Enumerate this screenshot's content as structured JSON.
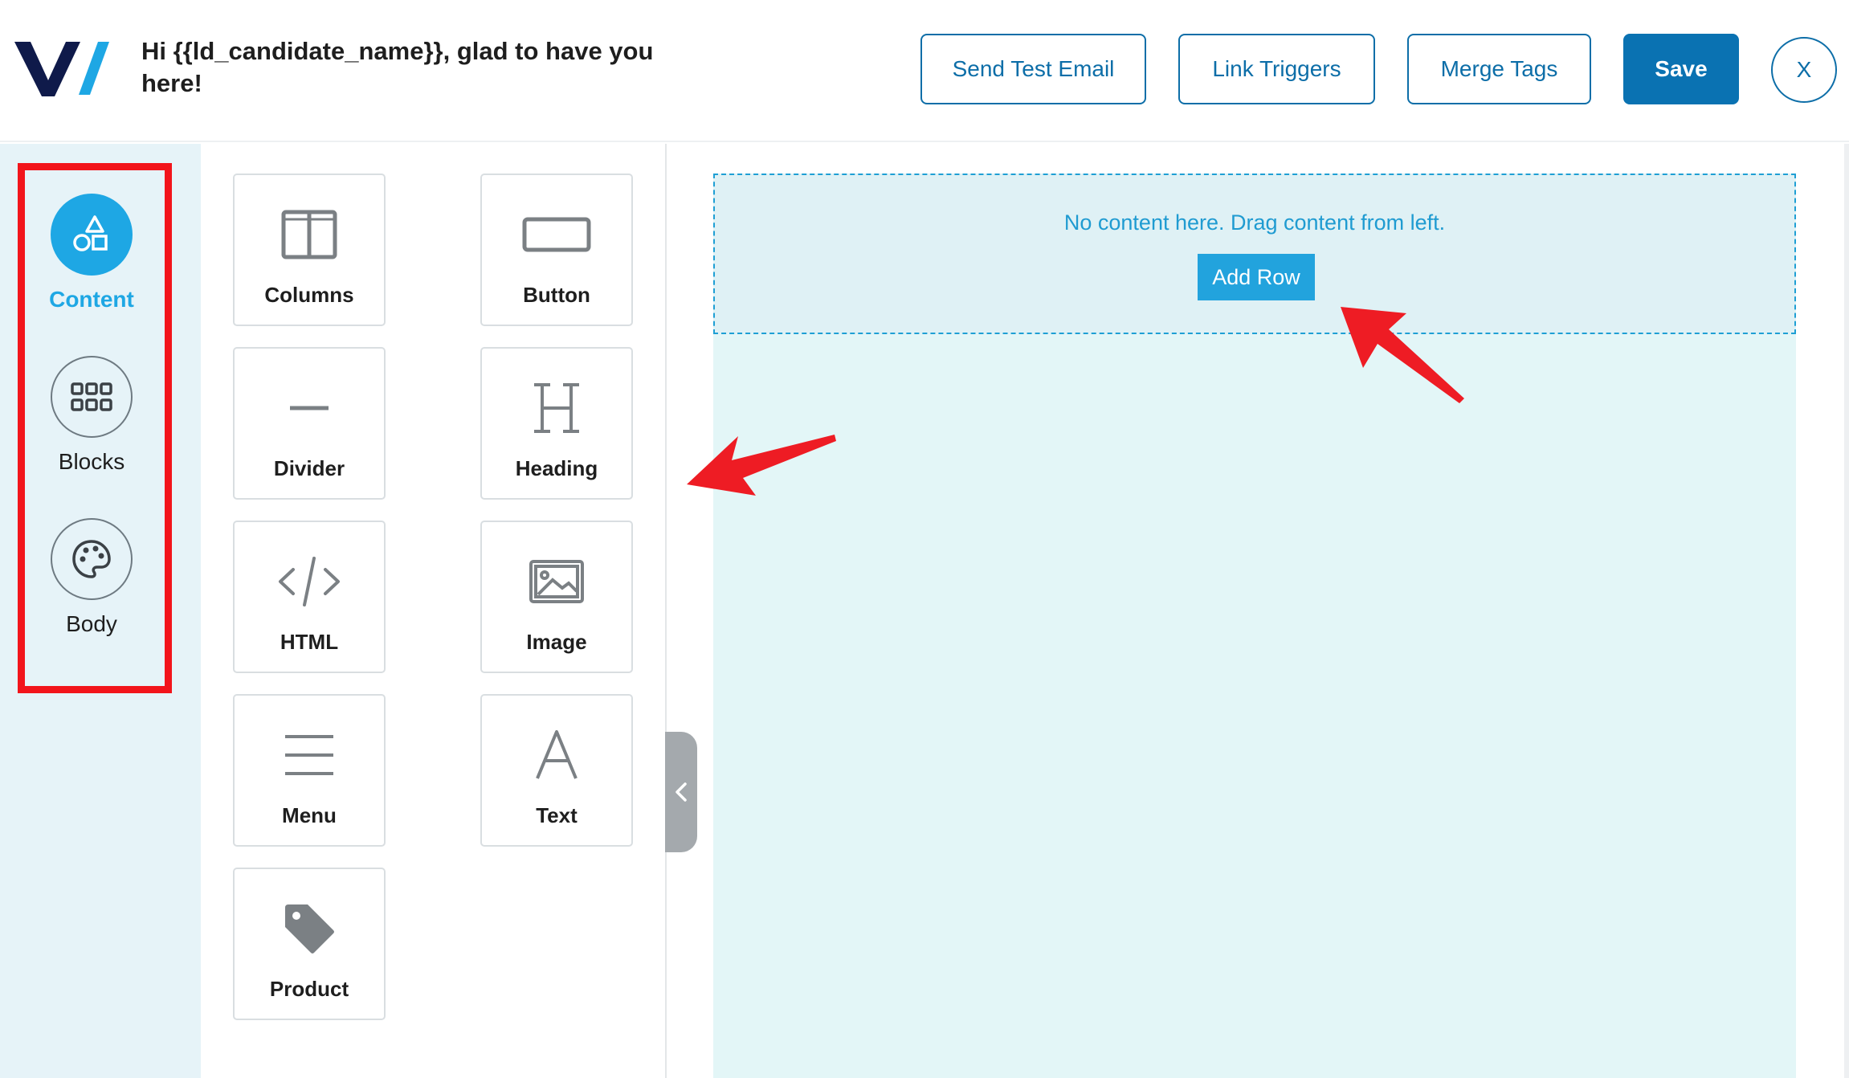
{
  "header": {
    "subject": "Hi {{ld_candidate_name}}, glad to have you here!",
    "buttons": {
      "send_test_email": "Send Test Email",
      "link_triggers": "Link Triggers",
      "merge_tags": "Merge Tags",
      "save": "Save",
      "close": "X"
    }
  },
  "rail": {
    "items": [
      {
        "label": "Content",
        "icon": "shapes-icon",
        "active": true
      },
      {
        "label": "Blocks",
        "icon": "grid-icon",
        "active": false
      },
      {
        "label": "Body",
        "icon": "palette-icon",
        "active": false
      }
    ]
  },
  "tools": [
    {
      "label": "Columns",
      "icon": "columns-icon"
    },
    {
      "label": "Button",
      "icon": "button-icon"
    },
    {
      "label": "Divider",
      "icon": "divider-icon"
    },
    {
      "label": "Heading",
      "icon": "heading-icon"
    },
    {
      "label": "HTML",
      "icon": "code-icon"
    },
    {
      "label": "Image",
      "icon": "image-icon"
    },
    {
      "label": "Menu",
      "icon": "menu-icon"
    },
    {
      "label": "Text",
      "icon": "text-icon"
    },
    {
      "label": "Product",
      "icon": "tag-icon"
    }
  ],
  "canvas": {
    "empty_message": "No content here. Drag content from left.",
    "add_row_label": "Add Row"
  },
  "colors": {
    "primary": "#0a72b2",
    "accent": "#1ea7e4",
    "highlight": "#f2141b"
  }
}
